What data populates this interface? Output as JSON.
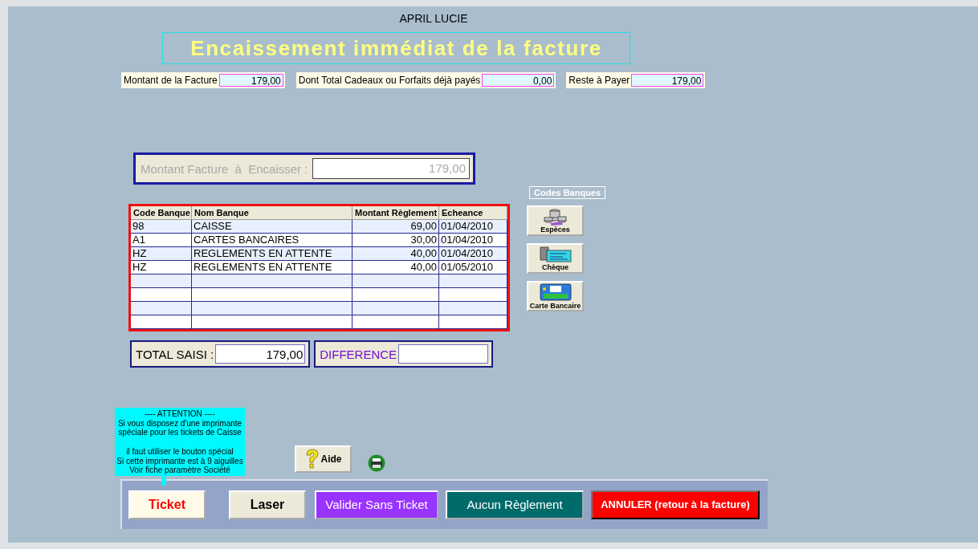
{
  "client_name": "APRIL LUCIE",
  "title": "Encaissement immédiat de la facture",
  "summary": [
    {
      "label": "Montant de la Facture",
      "value": "179,00"
    },
    {
      "label": "Dont Total Cadeaux ou Forfaits déjà payés",
      "value": "0,00"
    },
    {
      "label": "Reste à Payer",
      "value": "179,00"
    }
  ],
  "amount_to_collect": {
    "label": "Montant Facture  à  Encaisser :",
    "value": "179,00",
    "disabled": true
  },
  "bank_codes": {
    "title": "Codes Banques",
    "buttons": [
      {
        "label": "Espèces",
        "kind": "cash"
      },
      {
        "label": "Chèque",
        "kind": "cheque"
      },
      {
        "label": "Carte Bancaire",
        "kind": "card"
      }
    ]
  },
  "table": {
    "columns": [
      "Code Banque",
      "Nom Banque",
      "Montant Règlement",
      "Echeance"
    ],
    "rows": [
      [
        "98",
        "CAISSE",
        "69,00",
        "01/04/2010"
      ],
      [
        "A1",
        "CARTES BANCAIRES",
        "30,00",
        "01/04/2010"
      ],
      [
        "HZ",
        "REGLEMENTS EN ATTENTE",
        "40,00",
        "01/04/2010"
      ],
      [
        "HZ",
        "REGLEMENTS EN ATTENTE",
        "40,00",
        "01/05/2010"
      ]
    ]
  },
  "total": {
    "label": "TOTAL SAISI :",
    "value": "179,00"
  },
  "difference": {
    "label": "DIFFERENCE"
  },
  "notice": {
    "text": "---- ATTENTION ----\nSi vous disposez d'une imprimante\nspéciale pour les tickets de Caisse\n\nil faut utiliser le bouton spécial\nSi cette imprimante est à 9 aiguilles\nVoir fiche paramètre Société"
  },
  "help_button": {
    "label": "Aide"
  },
  "actions": [
    {
      "label": "Ticket",
      "kind": "ticket"
    },
    {
      "label": "Laser",
      "kind": "laser"
    },
    {
      "label": "Valider Sans Ticket",
      "kind": "validate"
    },
    {
      "label": "Aucun Règlement",
      "kind": "none"
    },
    {
      "label": "ANNULER (retour à la facture)",
      "kind": "cancel"
    }
  ]
}
